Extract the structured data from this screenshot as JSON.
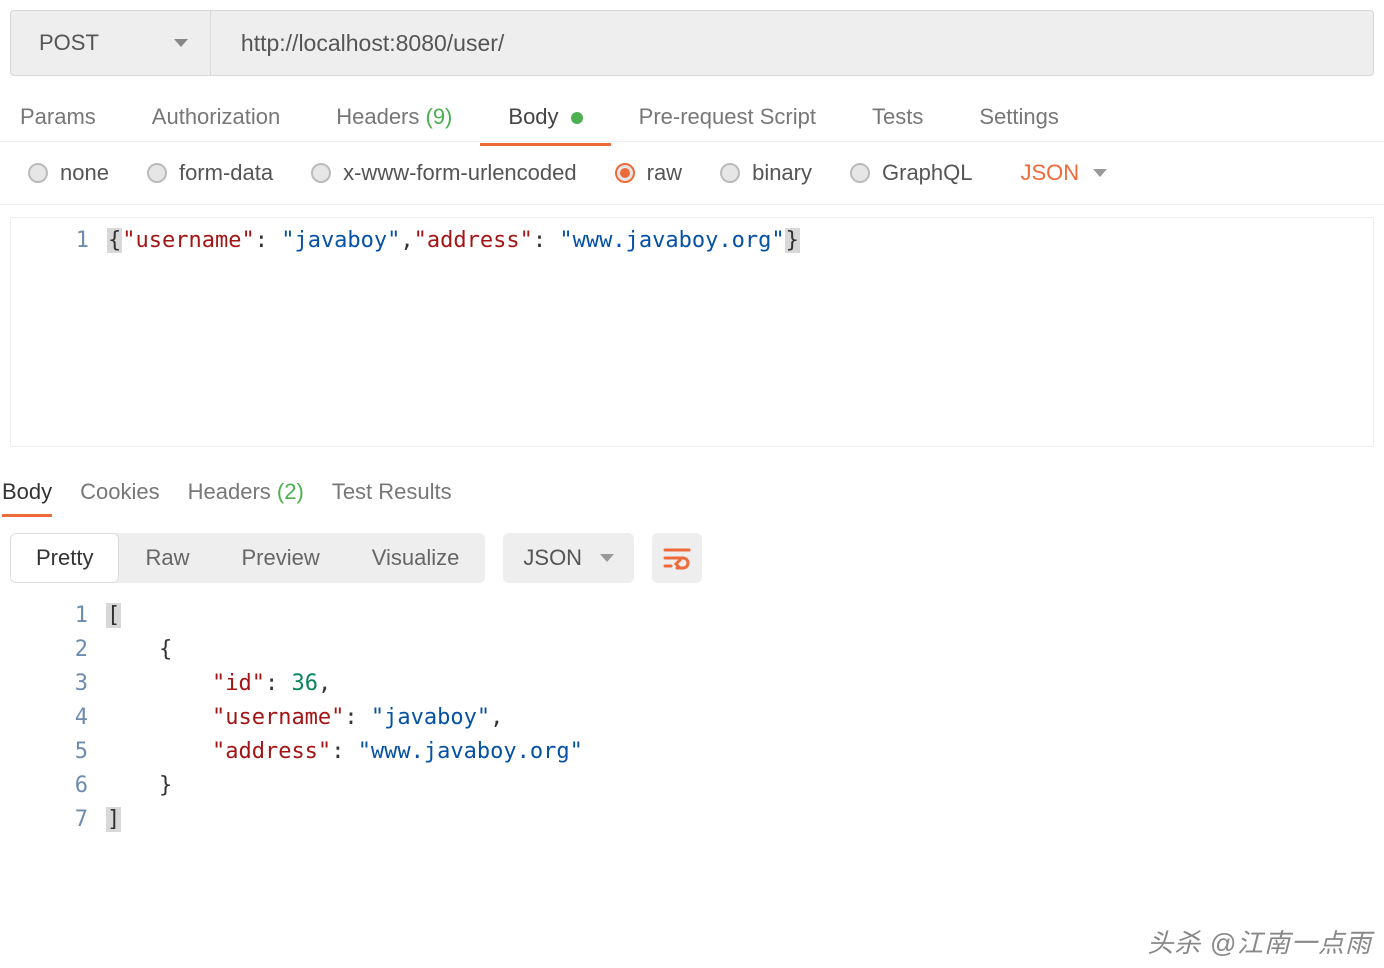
{
  "request": {
    "method": "POST",
    "url": "http://localhost:8080/user/"
  },
  "tabs": {
    "params": "Params",
    "authorization": "Authorization",
    "headers_label": "Headers",
    "headers_count": "(9)",
    "body": "Body",
    "prerequest": "Pre-request Script",
    "tests": "Tests",
    "settings": "Settings"
  },
  "body_types": {
    "none": "none",
    "form_data": "form-data",
    "urlencoded": "x-www-form-urlencoded",
    "raw": "raw",
    "binary": "binary",
    "graphql": "GraphQL",
    "content_type": "JSON"
  },
  "request_body": {
    "line_no": "1",
    "key1": "\"username\"",
    "val1": "\"javaboy\"",
    "key2": "\"address\"",
    "val2": "\"www.javaboy.org\""
  },
  "response_tabs": {
    "body": "Body",
    "cookies": "Cookies",
    "headers_label": "Headers",
    "headers_count": "(2)",
    "test_results": "Test Results"
  },
  "toolbar": {
    "pretty": "Pretty",
    "raw": "Raw",
    "preview": "Preview",
    "visualize": "Visualize",
    "format": "JSON"
  },
  "response_body": {
    "l1": "1",
    "l2": "2",
    "l3": "3",
    "l4": "4",
    "l5": "5",
    "l6": "6",
    "l7": "7",
    "id_key": "\"id\"",
    "id_val": "36",
    "user_key": "\"username\"",
    "user_val": "\"javaboy\"",
    "addr_key": "\"address\"",
    "addr_val": "\"www.javaboy.org\""
  },
  "watermark": "头杀 @江南一点雨"
}
